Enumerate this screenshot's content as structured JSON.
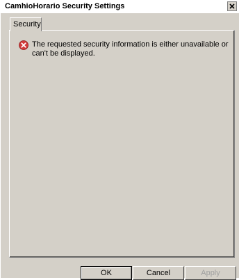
{
  "window": {
    "title": "CamhioHorario Security Settings"
  },
  "tabs": [
    {
      "label": "Security"
    }
  ],
  "error": {
    "message": "The requested security information is either unavailable or can't be displayed."
  },
  "buttons": {
    "ok": "OK",
    "cancel": "Cancel",
    "apply": "Apply"
  },
  "icons": {
    "close": "close-icon",
    "error": "error-icon"
  },
  "colors": {
    "error_red": "#d23c3c",
    "dialog_bg": "#d4d0c8",
    "disabled_text": "#a0a0a0"
  }
}
